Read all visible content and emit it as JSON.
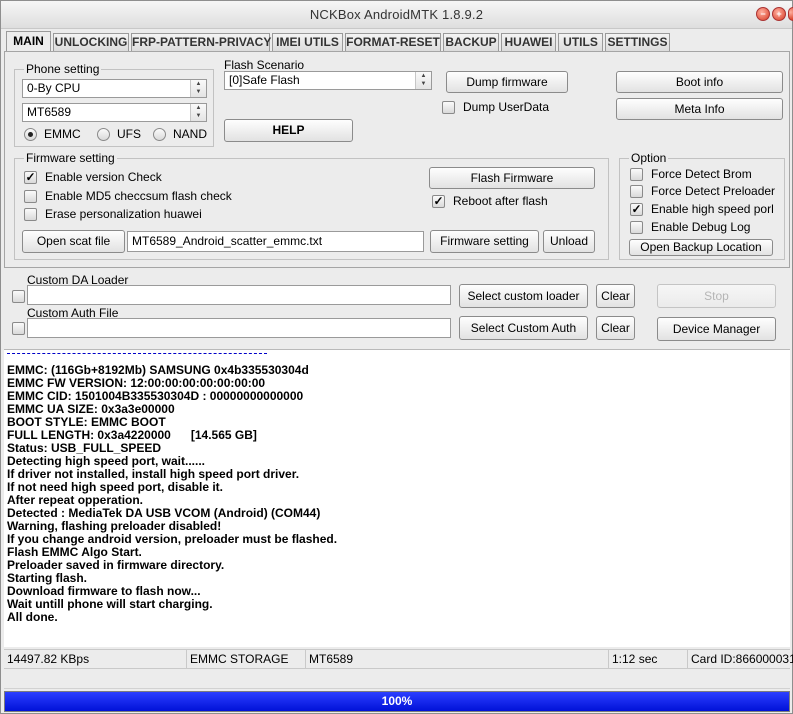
{
  "window": {
    "title": "NCKBox AndroidMTK 1.8.9.2"
  },
  "tabs": [
    "MAIN",
    "UNLOCKING",
    "FRP-PATTERN-PRIVACY",
    "IMEI UTILS",
    "FORMAT-RESET",
    "BACKUP",
    "HUAWEI",
    "UTILS",
    "SETTINGS"
  ],
  "active_tab": "MAIN",
  "phone_setting": {
    "label": "Phone setting",
    "cpu": "0-By CPU",
    "model": "MT6589",
    "storage": [
      {
        "label": "EMMC",
        "selected": true
      },
      {
        "label": "UFS",
        "selected": false
      },
      {
        "label": "NAND",
        "selected": false
      }
    ]
  },
  "flash_scenario": {
    "label": "Flash Scenario",
    "value": "[0]Safe Flash"
  },
  "buttons": {
    "dump_firmware": "Dump firmware",
    "help": "HELP",
    "boot_info": "Boot info",
    "meta_info": "Meta Info",
    "flash_firmware": "Flash Firmware",
    "open_scat": "Open scat file",
    "firmware_setting": "Firmware setting",
    "unload": "Unload",
    "open_backup": "Open Backup Location",
    "select_custom_loader": "Select custom loader",
    "select_custom_auth": "Select Custom Auth",
    "clear": "Clear",
    "stop": "Stop",
    "device_manager": "Device Manager"
  },
  "dump_userdata": {
    "label": "Dump UserData",
    "checked": false
  },
  "firmware_setting": {
    "label": "Firmware setting",
    "checks": [
      {
        "label": "Enable version Check",
        "checked": true
      },
      {
        "label": "Enable MD5 checcsum flash check",
        "checked": false
      },
      {
        "label": "Erase personalization huawei",
        "checked": false
      }
    ],
    "reboot_after_flash": {
      "label": "Reboot after flash",
      "checked": true
    },
    "scatter_file": "MT6589_Android_scatter_emmc.txt"
  },
  "option": {
    "label": "Option",
    "checks": [
      {
        "label": "Force Detect Brom",
        "checked": false
      },
      {
        "label": "Force Detect Preloader",
        "checked": false
      },
      {
        "label": "Enable high speed porl",
        "checked": true
      },
      {
        "label": "Enable Debug Log",
        "checked": false
      }
    ]
  },
  "custom_da": {
    "label": "Custom DA Loader",
    "value": ""
  },
  "custom_auth": {
    "label": "Custom Auth File",
    "value": ""
  },
  "log_lines": [
    "EMMC: (116Gb+8192Mb) SAMSUNG 0x4b335530304d",
    "EMMC FW VERSION: 12:00:00:00:00:00:00:00",
    "EMMC CID: 1501004B335530304D : 00000000000000",
    "EMMC UA SIZE: 0x3a3e00000",
    "BOOT STYLE: EMMC BOOT",
    "FULL LENGTH: 0x3a4220000      [14.565 GB]",
    "Status: USB_FULL_SPEED",
    "Detecting high speed port, wait......",
    "If driver not installed, install high speed port driver.",
    "If not need high speed port, disable it.",
    "After repeat opperation.",
    "Detected : MediaTek DA USB VCOM (Android) (COM44)",
    "Warning, flashing preloader disabled!",
    "If you change android version, preloader must be flashed.",
    "Flash EMMC Algo Start.",
    "Preloader saved in firmware directory.",
    "Starting flash.",
    "Download firmware to flash now...",
    "Wait untill phone will start charging.",
    "All done."
  ],
  "status_bar": {
    "speed": "14497.82 KBps",
    "storage": "EMMC STORAGE",
    "model": "MT6589",
    "time": "1:12 sec",
    "card_id": "Card ID:866000031"
  },
  "progress": {
    "value": 1.0,
    "label": "100%",
    "color": "#0a1ef0"
  }
}
